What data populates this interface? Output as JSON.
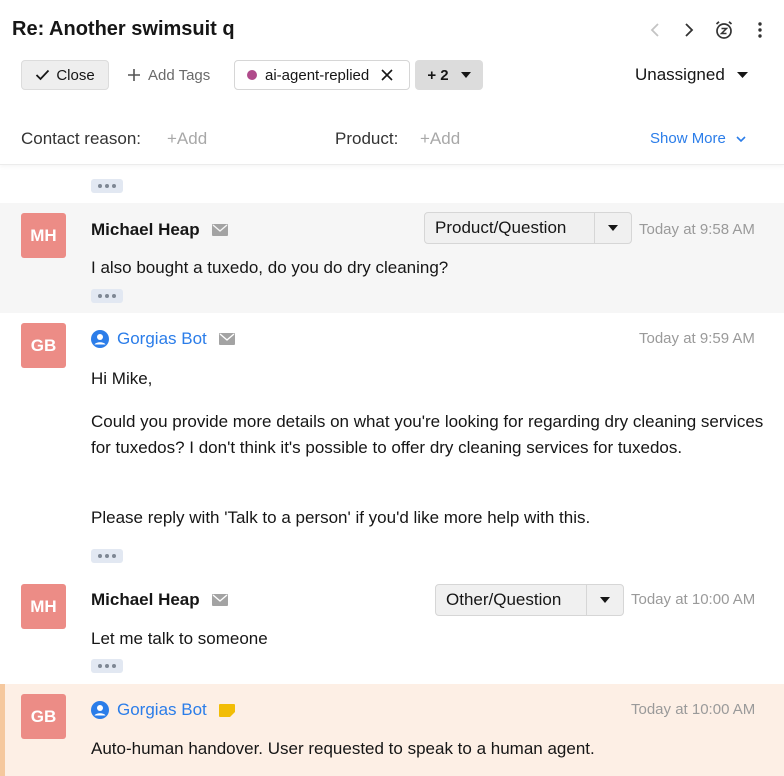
{
  "ticket": {
    "title": "Re: Another swimsuit q",
    "close_label": "Close",
    "add_tags_label": "Add Tags",
    "tag_label": "ai-agent-replied",
    "more_tags_label": "+ 2",
    "assignee_label": "Unassigned"
  },
  "fields": {
    "contact_reason_label": "Contact reason:",
    "contact_reason_add": "+Add",
    "product_label": "Product:",
    "product_add": "+Add",
    "show_more_label": "Show More"
  },
  "icons": {
    "prev": "chevron-left-icon",
    "next": "chevron-right-icon",
    "snooze": "snooze-clock-icon",
    "more": "vertical-dots-icon",
    "tag_color": "#b04b8b",
    "avatar_color": "#ec8c86",
    "bot_color": "#2b7de9",
    "note_color": "#f2bd06"
  },
  "messages": [
    {
      "initials": "MH",
      "sender": "Michael Heap",
      "intent": "Product/Question",
      "timestamp": "Today at 9:58 AM",
      "body": [
        "I also bought a tuxedo, do you do dry cleaning?"
      ]
    },
    {
      "initials": "GB",
      "sender": "Gorgias Bot",
      "timestamp": "Today at 9:59 AM",
      "body": [
        "Hi Mike,",
        "Could you provide more details on what you're looking for regarding dry cleaning services for tuxedos? I don't think it's possible to offer dry cleaning services for tuxedos.",
        "Please reply with 'Talk to a person' if you'd like more help with this."
      ]
    },
    {
      "initials": "MH",
      "sender": "Michael Heap",
      "intent": "Other/Question",
      "timestamp": "Today at 10:00 AM",
      "body": [
        "Let me talk to someone"
      ]
    },
    {
      "initials": "GB",
      "sender": "Gorgias Bot",
      "timestamp": "Today at 10:00 AM",
      "body": [
        "Auto-human handover. User requested to speak to a human agent."
      ]
    }
  ]
}
